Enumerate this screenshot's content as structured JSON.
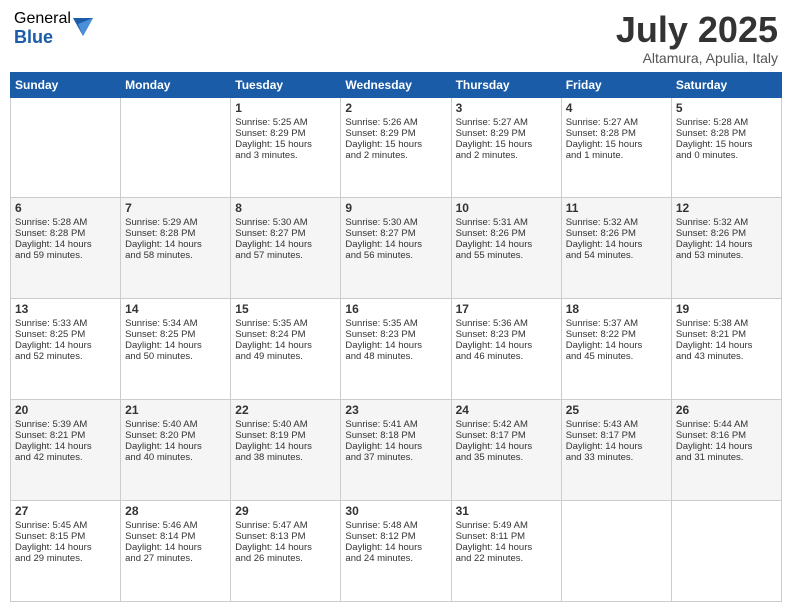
{
  "logo": {
    "general": "General",
    "blue": "Blue"
  },
  "header": {
    "month": "July 2025",
    "location": "Altamura, Apulia, Italy"
  },
  "days": [
    "Sunday",
    "Monday",
    "Tuesday",
    "Wednesday",
    "Thursday",
    "Friday",
    "Saturday"
  ],
  "weeks": [
    [
      {
        "day": "",
        "content": ""
      },
      {
        "day": "",
        "content": ""
      },
      {
        "day": "1",
        "content": "Sunrise: 5:25 AM\nSunset: 8:29 PM\nDaylight: 15 hours\nand 3 minutes."
      },
      {
        "day": "2",
        "content": "Sunrise: 5:26 AM\nSunset: 8:29 PM\nDaylight: 15 hours\nand 2 minutes."
      },
      {
        "day": "3",
        "content": "Sunrise: 5:27 AM\nSunset: 8:29 PM\nDaylight: 15 hours\nand 2 minutes."
      },
      {
        "day": "4",
        "content": "Sunrise: 5:27 AM\nSunset: 8:28 PM\nDaylight: 15 hours\nand 1 minute."
      },
      {
        "day": "5",
        "content": "Sunrise: 5:28 AM\nSunset: 8:28 PM\nDaylight: 15 hours\nand 0 minutes."
      }
    ],
    [
      {
        "day": "6",
        "content": "Sunrise: 5:28 AM\nSunset: 8:28 PM\nDaylight: 14 hours\nand 59 minutes."
      },
      {
        "day": "7",
        "content": "Sunrise: 5:29 AM\nSunset: 8:28 PM\nDaylight: 14 hours\nand 58 minutes."
      },
      {
        "day": "8",
        "content": "Sunrise: 5:30 AM\nSunset: 8:27 PM\nDaylight: 14 hours\nand 57 minutes."
      },
      {
        "day": "9",
        "content": "Sunrise: 5:30 AM\nSunset: 8:27 PM\nDaylight: 14 hours\nand 56 minutes."
      },
      {
        "day": "10",
        "content": "Sunrise: 5:31 AM\nSunset: 8:26 PM\nDaylight: 14 hours\nand 55 minutes."
      },
      {
        "day": "11",
        "content": "Sunrise: 5:32 AM\nSunset: 8:26 PM\nDaylight: 14 hours\nand 54 minutes."
      },
      {
        "day": "12",
        "content": "Sunrise: 5:32 AM\nSunset: 8:26 PM\nDaylight: 14 hours\nand 53 minutes."
      }
    ],
    [
      {
        "day": "13",
        "content": "Sunrise: 5:33 AM\nSunset: 8:25 PM\nDaylight: 14 hours\nand 52 minutes."
      },
      {
        "day": "14",
        "content": "Sunrise: 5:34 AM\nSunset: 8:25 PM\nDaylight: 14 hours\nand 50 minutes."
      },
      {
        "day": "15",
        "content": "Sunrise: 5:35 AM\nSunset: 8:24 PM\nDaylight: 14 hours\nand 49 minutes."
      },
      {
        "day": "16",
        "content": "Sunrise: 5:35 AM\nSunset: 8:23 PM\nDaylight: 14 hours\nand 48 minutes."
      },
      {
        "day": "17",
        "content": "Sunrise: 5:36 AM\nSunset: 8:23 PM\nDaylight: 14 hours\nand 46 minutes."
      },
      {
        "day": "18",
        "content": "Sunrise: 5:37 AM\nSunset: 8:22 PM\nDaylight: 14 hours\nand 45 minutes."
      },
      {
        "day": "19",
        "content": "Sunrise: 5:38 AM\nSunset: 8:21 PM\nDaylight: 14 hours\nand 43 minutes."
      }
    ],
    [
      {
        "day": "20",
        "content": "Sunrise: 5:39 AM\nSunset: 8:21 PM\nDaylight: 14 hours\nand 42 minutes."
      },
      {
        "day": "21",
        "content": "Sunrise: 5:40 AM\nSunset: 8:20 PM\nDaylight: 14 hours\nand 40 minutes."
      },
      {
        "day": "22",
        "content": "Sunrise: 5:40 AM\nSunset: 8:19 PM\nDaylight: 14 hours\nand 38 minutes."
      },
      {
        "day": "23",
        "content": "Sunrise: 5:41 AM\nSunset: 8:18 PM\nDaylight: 14 hours\nand 37 minutes."
      },
      {
        "day": "24",
        "content": "Sunrise: 5:42 AM\nSunset: 8:17 PM\nDaylight: 14 hours\nand 35 minutes."
      },
      {
        "day": "25",
        "content": "Sunrise: 5:43 AM\nSunset: 8:17 PM\nDaylight: 14 hours\nand 33 minutes."
      },
      {
        "day": "26",
        "content": "Sunrise: 5:44 AM\nSunset: 8:16 PM\nDaylight: 14 hours\nand 31 minutes."
      }
    ],
    [
      {
        "day": "27",
        "content": "Sunrise: 5:45 AM\nSunset: 8:15 PM\nDaylight: 14 hours\nand 29 minutes."
      },
      {
        "day": "28",
        "content": "Sunrise: 5:46 AM\nSunset: 8:14 PM\nDaylight: 14 hours\nand 27 minutes."
      },
      {
        "day": "29",
        "content": "Sunrise: 5:47 AM\nSunset: 8:13 PM\nDaylight: 14 hours\nand 26 minutes."
      },
      {
        "day": "30",
        "content": "Sunrise: 5:48 AM\nSunset: 8:12 PM\nDaylight: 14 hours\nand 24 minutes."
      },
      {
        "day": "31",
        "content": "Sunrise: 5:49 AM\nSunset: 8:11 PM\nDaylight: 14 hours\nand 22 minutes."
      },
      {
        "day": "",
        "content": ""
      },
      {
        "day": "",
        "content": ""
      }
    ]
  ]
}
